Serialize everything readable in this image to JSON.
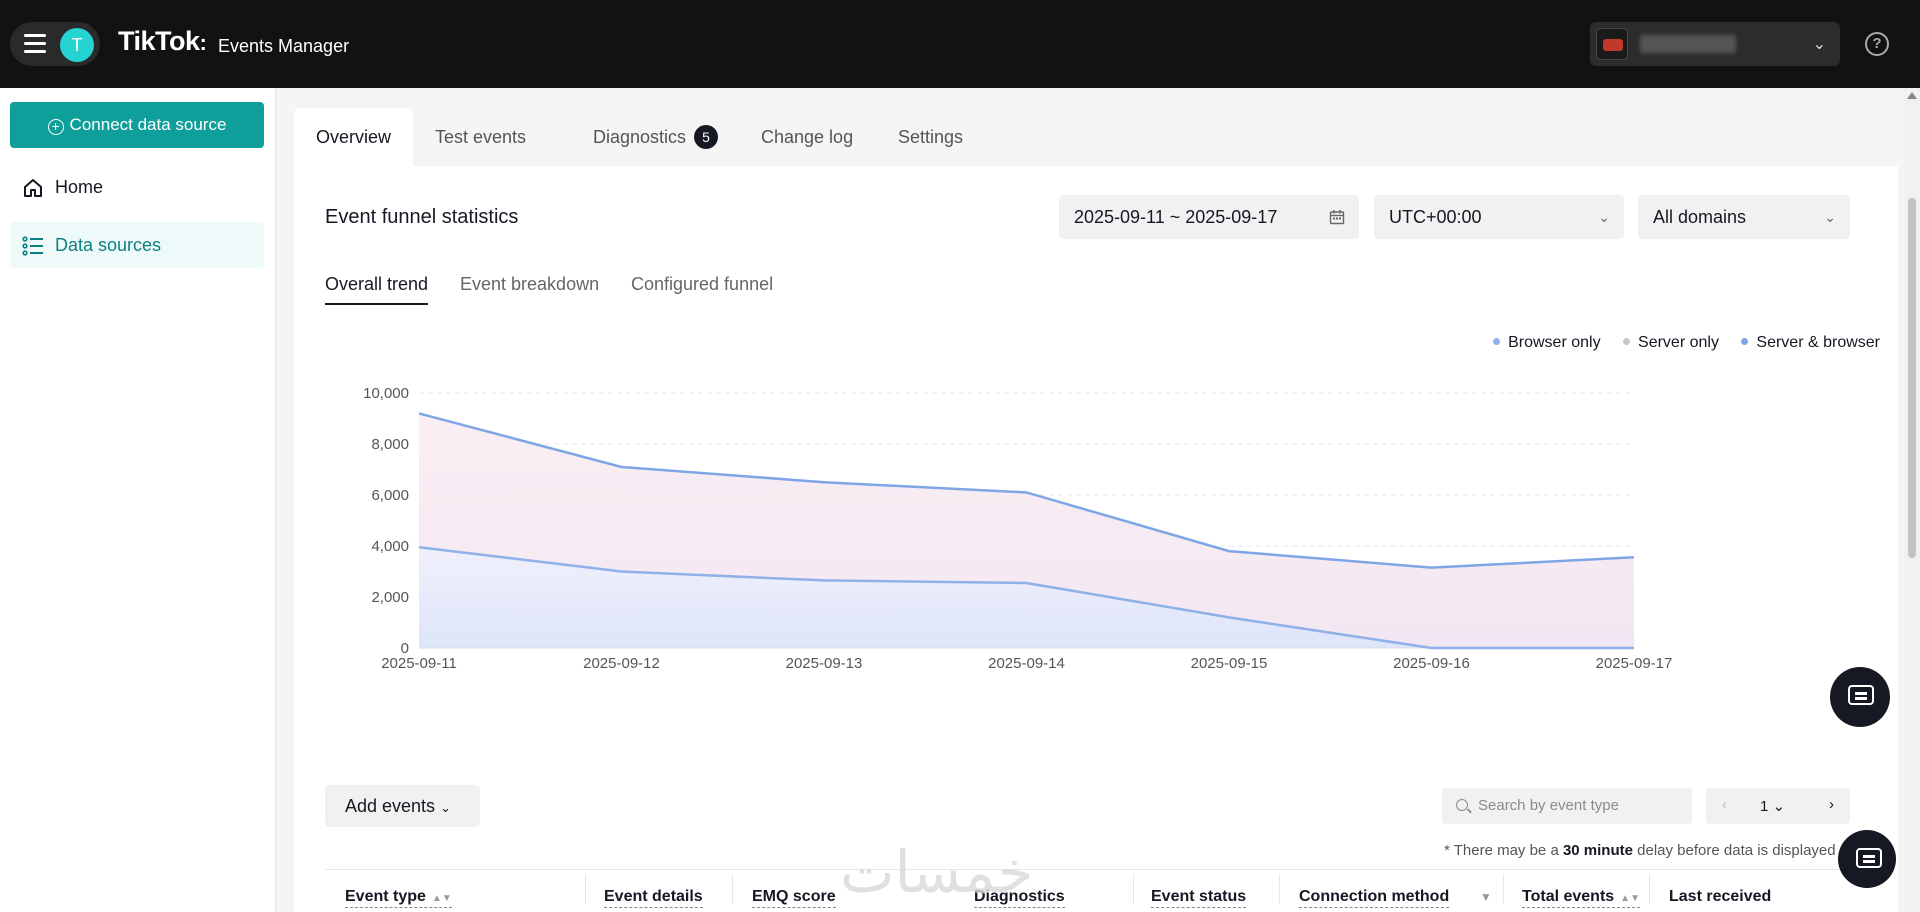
{
  "app": {
    "logo": "TikTok",
    "logo_separator": ":",
    "product": "Events Manager",
    "avatar_letter": "T"
  },
  "sidebar": {
    "connect_label": "Connect data source",
    "items": [
      {
        "label": "Home",
        "icon": "home-icon"
      },
      {
        "label": "Data sources",
        "icon": "list-icon"
      }
    ]
  },
  "tabs": [
    {
      "label": "Overview"
    },
    {
      "label": "Test events"
    },
    {
      "label": "Diagnostics",
      "badge": "5"
    },
    {
      "label": "Change log"
    },
    {
      "label": "Settings"
    }
  ],
  "funnel": {
    "title": "Event funnel statistics",
    "date_range": "2025-09-11 ~ 2025-09-17",
    "timezone": "UTC+00:00",
    "domain": "All domains",
    "subtabs": [
      "Overall trend",
      "Event breakdown",
      "Configured funnel"
    ]
  },
  "chart_data": {
    "type": "area",
    "x": [
      "2025-09-11",
      "2025-09-12",
      "2025-09-13",
      "2025-09-14",
      "2025-09-15",
      "2025-09-16",
      "2025-09-17"
    ],
    "ylim": [
      0,
      10000
    ],
    "yticks": [
      "0",
      "2,000",
      "4,000",
      "6,000",
      "8,000",
      "10,000"
    ],
    "legend": "top-right",
    "grid": true,
    "series": [
      {
        "name": "Browser only",
        "color": "#8fb0e8",
        "values": [
          3950,
          3000,
          2650,
          2550,
          1200,
          0,
          0
        ]
      },
      {
        "name": "Server only",
        "color": "#c8c8cc",
        "values": [
          0,
          0,
          0,
          0,
          0,
          0,
          0
        ]
      },
      {
        "name": "Server & browser",
        "color": "#7ea6e6",
        "values": [
          5250,
          4100,
          3850,
          3550,
          2600,
          3150,
          3560
        ]
      }
    ],
    "total_line": [
      9200,
      7100,
      6500,
      6100,
      3800,
      3150,
      3560
    ]
  },
  "table_tools": {
    "add_events": "Add events",
    "search_placeholder": "Search by event type",
    "page": "1",
    "note_prefix": "* There may be a ",
    "note_bold": "30 minute",
    "note_suffix": " delay before data is displayed"
  },
  "table": {
    "headers": [
      "Event type",
      "Event details",
      "EMQ score",
      "Diagnostics",
      "Event status",
      "Connection method",
      "Total events",
      "Last received"
    ]
  },
  "colors": {
    "accent": "#0e9f9a",
    "topbar": "#121212"
  }
}
